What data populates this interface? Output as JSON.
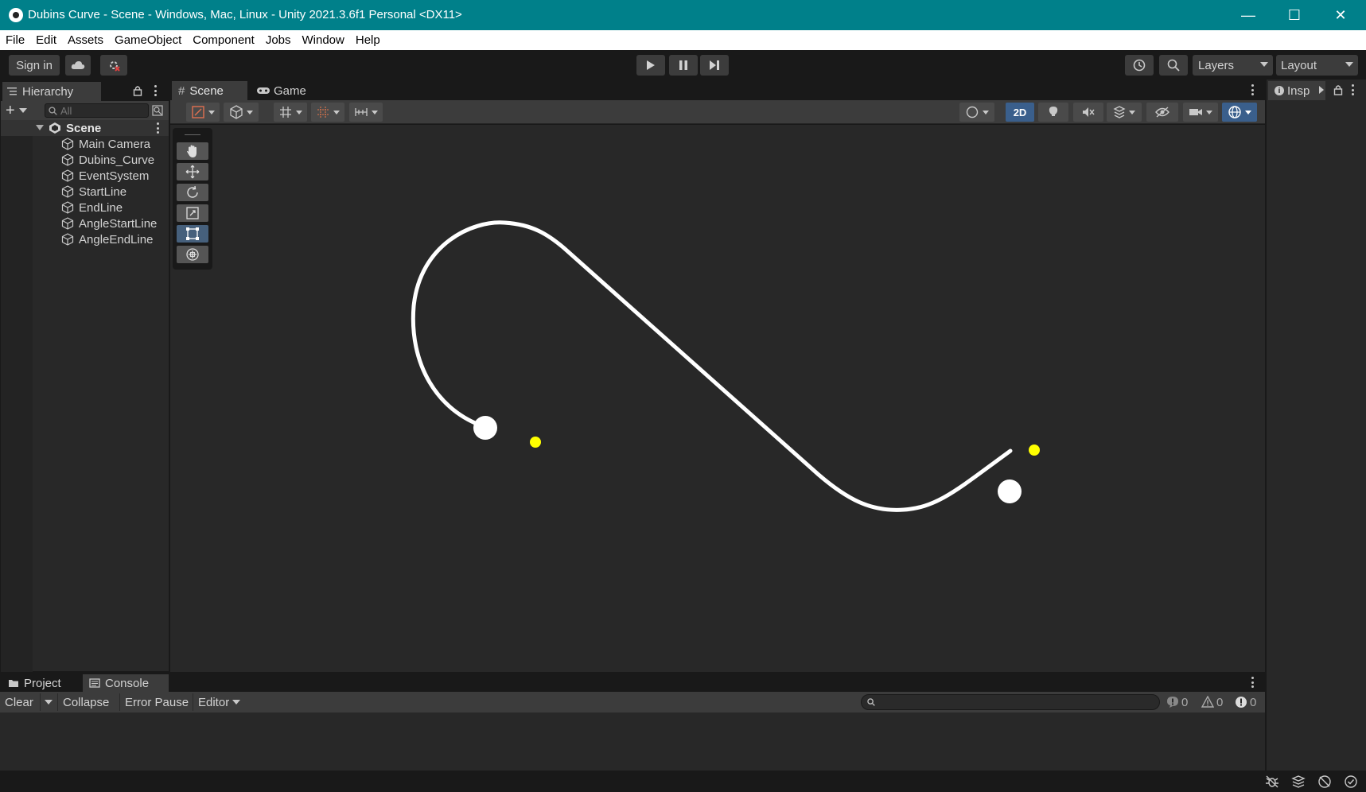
{
  "window": {
    "title": "Dubins Curve - Scene - Windows, Mac, Linux - Unity 2021.3.6f1 Personal <DX11>",
    "minimize": "—",
    "maximize": "☐",
    "close": "✕"
  },
  "menu": [
    "File",
    "Edit",
    "Assets",
    "GameObject",
    "Component",
    "Jobs",
    "Window",
    "Help"
  ],
  "toolbar": {
    "signin_label": "Sign in",
    "layers_label": "Layers",
    "layout_label": "Layout"
  },
  "hierarchy": {
    "tab_label": "Hierarchy",
    "search_placeholder": "All",
    "scene_name": "Scene",
    "items": [
      "Main Camera",
      "Dubins_Curve",
      "EventSystem",
      "StartLine",
      "EndLine",
      "AngleStartLine",
      "AngleEndLine"
    ]
  },
  "scene_view": {
    "tabs": [
      "Scene",
      "Game"
    ],
    "mode_2d": "2D",
    "tools": [
      "hand-tool",
      "move-tool",
      "rotate-tool",
      "scale-tool",
      "rect-tool",
      "transform-tool"
    ],
    "active_tool": "rect-tool",
    "curve_color": "#ffffff",
    "marker_color": "#ffff00",
    "background_color": "#282828"
  },
  "inspector": {
    "tab_label": "Insp"
  },
  "console": {
    "tabs": [
      "Project",
      "Console"
    ],
    "buttons": {
      "clear": "Clear",
      "collapse": "Collapse",
      "error_pause": "Error Pause",
      "editor": "Editor"
    },
    "counts": {
      "log": "0",
      "warning": "0",
      "error": "0"
    }
  },
  "colors": {
    "titlebar": "#00808a",
    "panel": "#282828",
    "toolbar": "#3c3c3c",
    "accent_2d": "#3a5f8c"
  }
}
